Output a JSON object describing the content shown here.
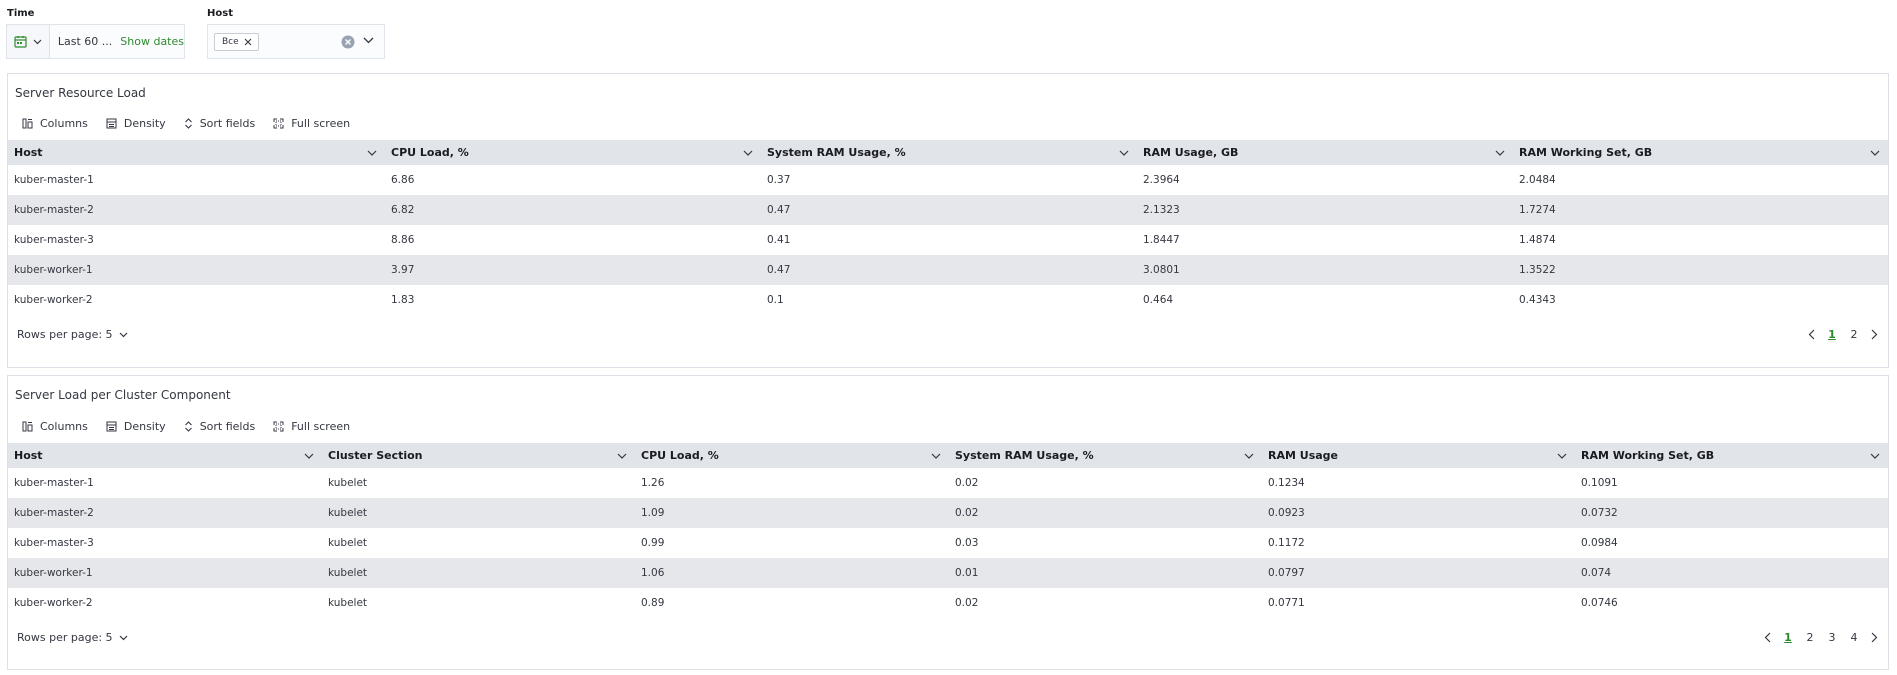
{
  "filters": {
    "time": {
      "label": "Time",
      "range_text": "Last 60 ...",
      "show_dates": "Show dates"
    },
    "host": {
      "label": "Host",
      "selected_pill": "Все"
    }
  },
  "panel1": {
    "title": "Server Resource Load",
    "toolbar": {
      "columns": "Columns",
      "density": "Density",
      "sort": "Sort fields",
      "fullscreen": "Full screen"
    },
    "headers": [
      "Host",
      "CPU Load, %",
      "System RAM Usage, %",
      "RAM Usage, GB",
      "RAM Working Set, GB"
    ],
    "rows": [
      [
        "kuber-master-1",
        "6.86",
        "0.37",
        "2.3964",
        "2.0484"
      ],
      [
        "kuber-master-2",
        "6.82",
        "0.47",
        "2.1323",
        "1.7274"
      ],
      [
        "kuber-master-3",
        "8.86",
        "0.41",
        "1.8447",
        "1.4874"
      ],
      [
        "kuber-worker-1",
        "3.97",
        "0.47",
        "3.0801",
        "1.3522"
      ],
      [
        "kuber-worker-2",
        "1.83",
        "0.1",
        "0.464",
        "0.4343"
      ]
    ],
    "rows_per_page": "Rows per page: 5",
    "pages": [
      "1",
      "2"
    ],
    "active_page": "1"
  },
  "panel2": {
    "title": "Server Load per Cluster Component",
    "toolbar": {
      "columns": "Columns",
      "density": "Density",
      "sort": "Sort fields",
      "fullscreen": "Full screen"
    },
    "headers": [
      "Host",
      "Cluster Section",
      "CPU Load, %",
      "System RAM Usage, %",
      "RAM Usage",
      "RAM Working Set, GB"
    ],
    "rows": [
      [
        "kuber-master-1",
        "kubelet",
        "1.26",
        "0.02",
        "0.1234",
        "0.1091"
      ],
      [
        "kuber-master-2",
        "kubelet",
        "1.09",
        "0.02",
        "0.0923",
        "0.0732"
      ],
      [
        "kuber-master-3",
        "kubelet",
        "0.99",
        "0.03",
        "0.1172",
        "0.0984"
      ],
      [
        "kuber-worker-1",
        "kubelet",
        "1.06",
        "0.01",
        "0.0797",
        "0.074"
      ],
      [
        "kuber-worker-2",
        "kubelet",
        "0.89",
        "0.02",
        "0.0771",
        "0.0746"
      ]
    ],
    "rows_per_page": "Rows per page: 5",
    "pages": [
      "1",
      "2",
      "3",
      "4"
    ],
    "active_page": "1"
  },
  "colors": {
    "accent": "#2f8a2f",
    "header_bg": "#e1e4e8",
    "row_alt_bg": "#e6e7ea",
    "border": "#dde1e7"
  }
}
